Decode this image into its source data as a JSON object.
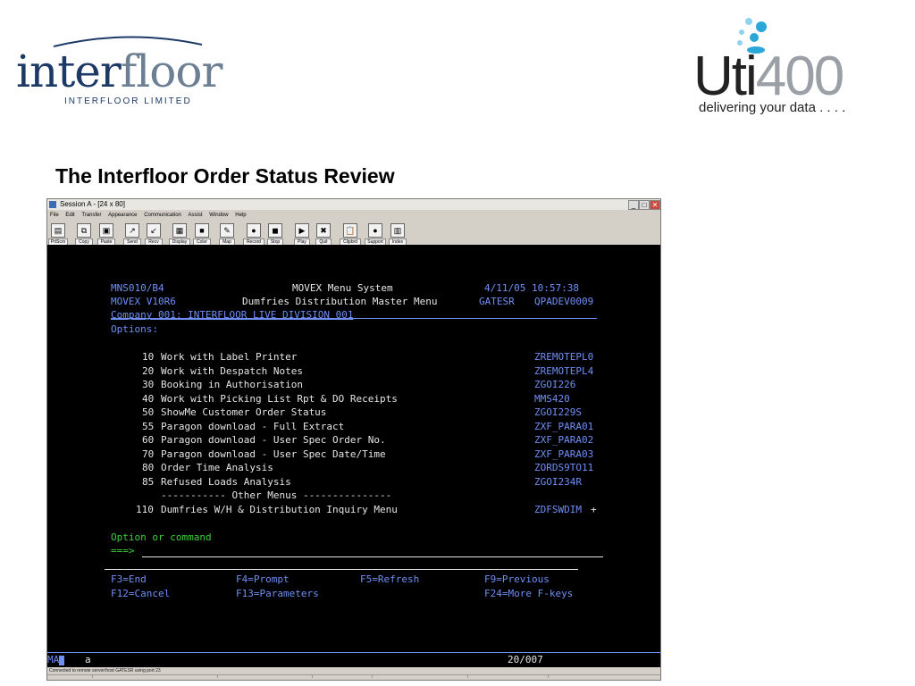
{
  "slide": {
    "title": "The Interfloor Order Status Review",
    "left_logo": {
      "inter": "inter",
      "floor": "floor",
      "subtitle": "INTERFLOOR LIMITED"
    },
    "right_logo": {
      "uti": "Uti",
      "num": "400",
      "tagline": "delivering your data . . . ."
    }
  },
  "window": {
    "title": "Session A - [24 x 80]",
    "buttons": {
      "minimize": "_",
      "maximize": "□",
      "close": "✕"
    },
    "menu": [
      "File",
      "Edit",
      "Transfer",
      "Appearance",
      "Communication",
      "Assist",
      "Window",
      "Help"
    ],
    "toolbar": [
      {
        "label": "PrtScrn",
        "icon": "print-screen-icon"
      },
      {
        "label": "Copy",
        "icon": "copy-icon"
      },
      {
        "label": "Paste",
        "icon": "paste-icon"
      },
      {
        "label": "Send",
        "icon": "send-icon"
      },
      {
        "label": "Recv",
        "icon": "receive-icon"
      },
      {
        "label": "Display",
        "icon": "display-icon"
      },
      {
        "label": "Color",
        "icon": "color-icon"
      },
      {
        "label": "Map",
        "icon": "map-icon"
      },
      {
        "label": "Record",
        "icon": "record-icon"
      },
      {
        "label": "Stop",
        "icon": "stop-icon"
      },
      {
        "label": "Play",
        "icon": "play-icon"
      },
      {
        "label": "Quit",
        "icon": "quit-icon"
      },
      {
        "label": "Clipbrd",
        "icon": "clipboard-icon"
      },
      {
        "label": "Support",
        "icon": "support-icon"
      },
      {
        "label": "Index",
        "icon": "index-icon"
      }
    ]
  },
  "screen": {
    "program": "MNS010/B4",
    "system": "MOVEX Menu System",
    "datetime": "4/11/05 10:57:38",
    "version": "MOVEX V10R6",
    "menu_title": "Dumfries Distribution Master Menu",
    "user": "GATESR",
    "device": "QPADEV0009",
    "company": "Company 001: INTERFLOOR LIVE DIVISION 001",
    "options_label": "Options:",
    "options": [
      {
        "num": "10",
        "text": "Work with Label Printer",
        "code": "ZREMOTEPL0"
      },
      {
        "num": "20",
        "text": "Work with Despatch Notes",
        "code": "ZREMOTEPL4"
      },
      {
        "num": "30",
        "text": "Booking in Authorisation",
        "code": "ZGOI226"
      },
      {
        "num": "40",
        "text": "Work with Picking List Rpt & DO Receipts",
        "code": "MMS420"
      },
      {
        "num": "50",
        "text": "ShowMe Customer Order Status",
        "code": "ZGOI229S"
      },
      {
        "num": "55",
        "text": "Paragon download - Full Extract",
        "code": "ZXF_PARA01"
      },
      {
        "num": "60",
        "text": "Paragon download - User Spec Order No.",
        "code": "ZXF_PARA02"
      },
      {
        "num": "70",
        "text": "Paragon download - User Spec Date/Time",
        "code": "ZXF_PARA03"
      },
      {
        "num": "80",
        "text": "Order Time Analysis",
        "code": "ZORDS9TO11"
      },
      {
        "num": "85",
        "text": "Refused Loads Analysis",
        "code": "ZGOI234R"
      }
    ],
    "other_menus": "----------- Other Menus ---------------",
    "submenu": {
      "num": "110",
      "text": "Dumfries W/H & Distribution Inquiry Menu",
      "code": "ZDFSWDIM",
      "more": "+"
    },
    "prompt_label": "Option or command",
    "prompt_arrow": "===>",
    "fkeys_row1": [
      "F3=End",
      "F4=Prompt",
      "F5=Refresh",
      "F9=Previous"
    ],
    "fkeys_row2": [
      "F12=Cancel",
      "F13=Parameters",
      "F24=More F-keys"
    ]
  },
  "oia": {
    "indicator": "MA",
    "session": "a",
    "cursor": "20/007"
  },
  "status_text": "Connected to remote server/host GATESR using port 23",
  "colors": {
    "terminal_bg": "#000000",
    "terminal_blue": "#6f8ff5",
    "terminal_green": "#3ecf3e",
    "terminal_white": "#e6e6e6",
    "brand_navy": "#1d3a66",
    "brand_cyan": "#2aa6d9"
  }
}
